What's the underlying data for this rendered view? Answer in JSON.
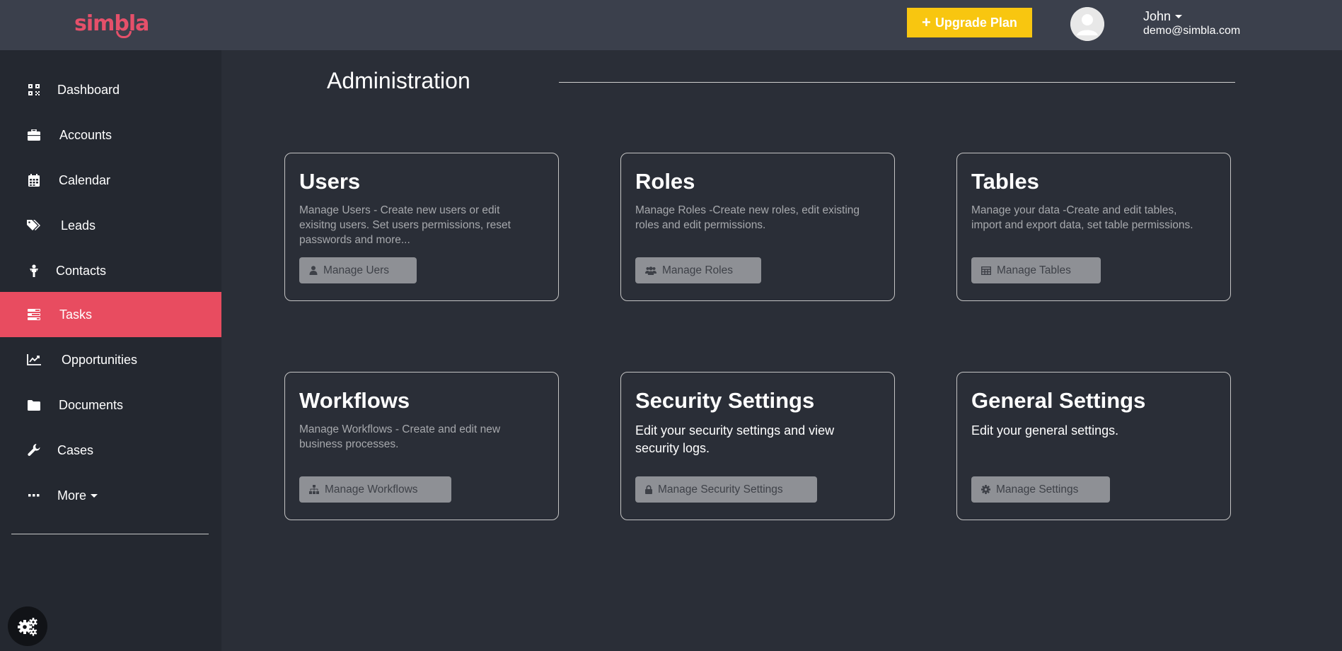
{
  "header": {
    "logo_text": "simbla",
    "upgrade_label": "Upgrade Plan",
    "user_name": "John",
    "user_email": "demo@simbla.com"
  },
  "sidebar": {
    "items": [
      {
        "label": "Dashboard",
        "icon": "qr-grid-icon"
      },
      {
        "label": "Accounts",
        "icon": "briefcase-icon"
      },
      {
        "label": "Calendar",
        "icon": "calendar-icon"
      },
      {
        "label": "Leads",
        "icon": "tags-icon"
      },
      {
        "label": "Contacts",
        "icon": "person-icon"
      },
      {
        "label": "Tasks",
        "icon": "tasks-list-icon",
        "active": true
      },
      {
        "label": "Opportunities",
        "icon": "line-chart-icon"
      },
      {
        "label": "Documents",
        "icon": "folder-icon"
      },
      {
        "label": "Cases",
        "icon": "wrench-icon"
      },
      {
        "label": "More",
        "icon": "ellipsis-icon"
      }
    ]
  },
  "main": {
    "title": "Administration",
    "cards": [
      {
        "title": "Users",
        "description": "Manage Users - Create new users or edit exisitng users. Set users permissions, reset passwords and more...",
        "button": "Manage Uers",
        "icon": "user-icon"
      },
      {
        "title": "Roles",
        "description": "Manage Roles -Create new roles, edit existing roles and edit permissions.",
        "button": "Manage Roles",
        "icon": "users-icon"
      },
      {
        "title": "Tables",
        "description": "Manage your data -Create and edit tables, import and export data, set table permissions.",
        "button": "Manage Tables",
        "icon": "table-icon"
      },
      {
        "title": "Workflows",
        "description": "Manage Workflows - Create and edit new business processes.",
        "button": "Manage Workflows",
        "icon": "sitemap-icon"
      },
      {
        "title": "Security Settings",
        "description": "Edit your security settings and view security logs.",
        "button": "Manage Security Settings",
        "icon": "lock-icon"
      },
      {
        "title": "General Settings",
        "description": "Edit  your general settings.",
        "button": "Manage Settings",
        "icon": "gear-icon"
      }
    ]
  },
  "colors": {
    "accent": "#e84c60",
    "upgrade": "#f8c610",
    "background": "#2a2e37",
    "sidebar": "#242830",
    "topbar": "#3b404c"
  }
}
